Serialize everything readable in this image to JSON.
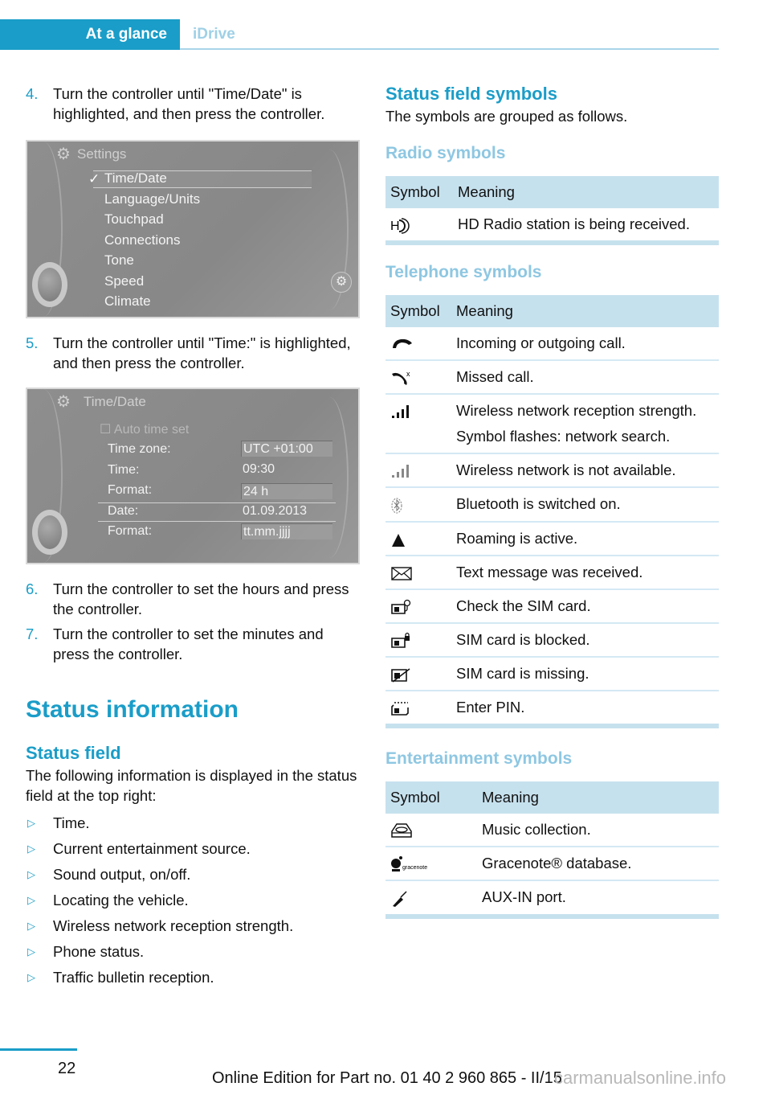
{
  "header": {
    "active_tab": "At a glance",
    "tab": "iDrive"
  },
  "left": {
    "steps_a": [
      {
        "num": "4.",
        "text": "Turn the controller until \"Time/Date\" is highlighted, and then press the controller."
      }
    ],
    "settings_screen": {
      "title": "Settings",
      "items": [
        "Time/Date",
        "Language/Units",
        "Touchpad",
        "Connections",
        "Tone",
        "Speed",
        "Climate"
      ],
      "selected": "Time/Date"
    },
    "steps_b": [
      {
        "num": "5.",
        "text": "Turn the controller until \"Time:\" is high­lighted, and then press the controller."
      }
    ],
    "timedate_screen": {
      "title": "Time/Date",
      "auto_time_set": "Auto time set",
      "rows": [
        {
          "label": "Time zone:",
          "value": "UTC +01:00",
          "boxed": true
        },
        {
          "label": "Time:",
          "value": "09:30",
          "boxed": false
        },
        {
          "label": "Format:",
          "value": "24 h",
          "boxed": true
        },
        {
          "label": "Date:",
          "value": "01.09.2013",
          "boxed": false
        },
        {
          "label": "Format:",
          "value": "tt.mm.jjjj",
          "boxed": true
        }
      ]
    },
    "steps_c": [
      {
        "num": "6.",
        "text": "Turn the controller to set the hours and press the controller."
      },
      {
        "num": "7.",
        "text": "Turn the controller to set the minutes and press the controller."
      }
    ],
    "section_title": "Status information",
    "subsection_title": "Status field",
    "intro": "The following information is displayed in the status field at the top right:",
    "bullets": [
      "Time.",
      "Current entertainment source.",
      "Sound output, on/off.",
      "Locating the vehicle.",
      "Wireless network reception strength.",
      "Phone status.",
      "Traffic bulletin reception."
    ]
  },
  "right": {
    "title": "Status field symbols",
    "intro": "The symbols are grouped as follows.",
    "col_symbol": "Symbol",
    "col_meaning": "Meaning",
    "groups": [
      {
        "title": "Radio symbols",
        "rows": [
          {
            "icon": "hd-radio-icon",
            "meaning": "HD Radio station is being received."
          }
        ]
      },
      {
        "title": "Telephone symbols",
        "rows": [
          {
            "icon": "phone-call-icon",
            "meaning": "Incoming or outgoing call."
          },
          {
            "icon": "missed-call-icon",
            "meaning": "Missed call."
          },
          {
            "icon": "signal-strength-icon",
            "meaning": "Wireless network reception strength.",
            "meaning2": "Symbol flashes: network search."
          },
          {
            "icon": "signal-unavailable-icon",
            "meaning": "Wireless network is not available."
          },
          {
            "icon": "bluetooth-icon",
            "meaning": "Bluetooth is switched on."
          },
          {
            "icon": "roaming-icon",
            "meaning": "Roaming is active."
          },
          {
            "icon": "envelope-icon",
            "meaning": "Text message was received."
          },
          {
            "icon": "sim-check-icon",
            "meaning": "Check the SIM card."
          },
          {
            "icon": "sim-blocked-icon",
            "meaning": "SIM card is blocked."
          },
          {
            "icon": "sim-missing-icon",
            "meaning": "SIM card is missing."
          },
          {
            "icon": "sim-pin-icon",
            "meaning": "Enter PIN."
          }
        ]
      },
      {
        "title": "Entertainment symbols",
        "rows": [
          {
            "icon": "music-collection-icon",
            "meaning": "Music collection."
          },
          {
            "icon": "gracenote-icon",
            "meaning": "Gracenote® database.",
            "icon_text": "gracenote"
          },
          {
            "icon": "aux-in-icon",
            "meaning": "AUX-IN port."
          }
        ]
      }
    ]
  },
  "footer": {
    "page_number": "22",
    "edition": "Online Edition for Part no. 01 40 2 960 865 - II/15",
    "watermark": "carmanualsonline.info"
  },
  "colors": {
    "accent": "#1a9dc8",
    "light_accent": "#8ec7e2",
    "table_header": "#c6e1ee"
  }
}
